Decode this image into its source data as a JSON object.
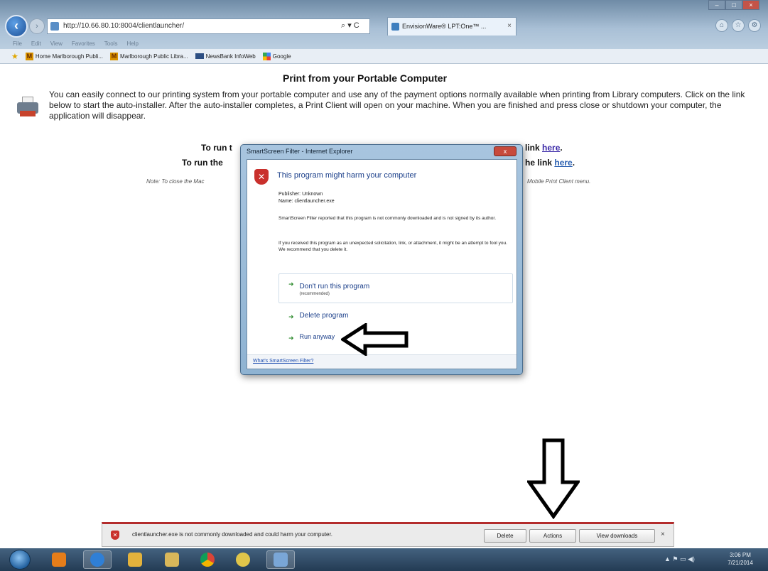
{
  "browser": {
    "address": "http://10.66.80.10:8004/clientlauncher/",
    "tab_title": "EnvisionWare® LPT:One™ ...",
    "tab_close": "×",
    "addr_tools": "⌕ ▾ C",
    "menu": [
      "File",
      "Edit",
      "View",
      "Favorites",
      "Tools",
      "Help"
    ],
    "favorites": [
      "Home Marlborough Publi...",
      "Marlborough Public Libra...",
      "NewsBank InfoWeb",
      "Google"
    ]
  },
  "page": {
    "title": "Print from your Portable Computer",
    "intro": "You can easily connect to our printing system from your portable computer and use any of the payment options normally available when printing from Library computers. Click on the link below to start the auto-installer. After the auto-installer completes, a Print Client will open on your machine. When you are finished and press close or shutdown your computer, the application will disappear.",
    "run1_prefix": "To run t",
    "run1_suffix": "link",
    "run2_prefix": "To run the",
    "run2_suffix": "he link",
    "link_text": "here",
    "note_left": "Note: To close the Mac",
    "note_right": "Mobile Print Client menu."
  },
  "dialog": {
    "title": "SmartScreen Filter - Internet Explorer",
    "heading": "This program might harm your computer",
    "publisher": "Publisher: Unknown",
    "name": "Name: clientlauncher.exe",
    "p1": "SmartScreen Filter reported that this program is not commonly downloaded and is not signed by its author.",
    "p2": "If you received this program as an unexpected solicitation, link, or attachment, it might be an attempt to fool you. We recommend that you delete it.",
    "opt1": "Don't run this program",
    "opt1_sub": "(recommended)",
    "opt2": "Delete program",
    "opt3": "Run anyway",
    "footer_link": "What's SmartScreen Filter?",
    "close_glyph": "x"
  },
  "notification": {
    "text": "clientlauncher.exe is not commonly downloaded and could harm your computer.",
    "delete": "Delete",
    "actions": "Actions",
    "view_downloads": "View downloads",
    "close": "×"
  },
  "taskbar": {
    "time": "3:06 PM",
    "date": "7/21/2014",
    "tray": "▲ ⚑ ▭ ◀)"
  },
  "colors": {
    "accent_red": "#b32c2c",
    "link_purple": "#3b2aa8",
    "dialog_heading": "#1b3f8a"
  }
}
